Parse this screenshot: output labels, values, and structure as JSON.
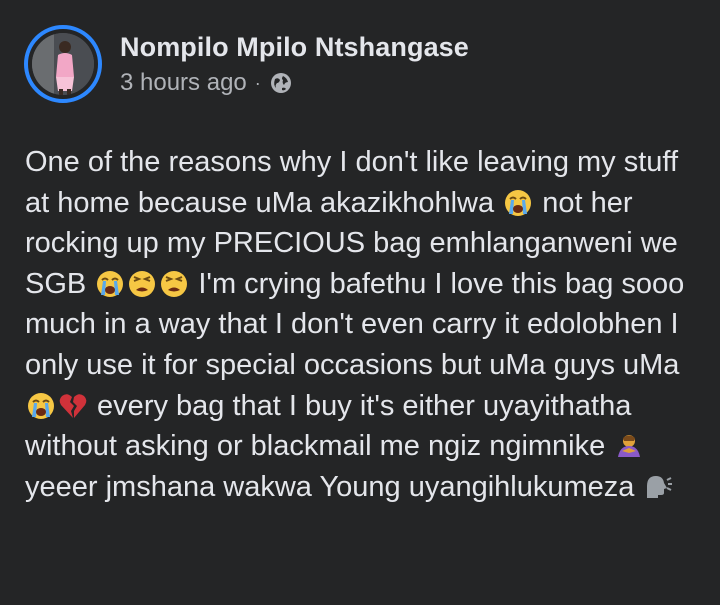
{
  "post": {
    "author_name": "Nompilo Mpilo Ntshangase",
    "timestamp": "3 hours ago",
    "separator": "·",
    "privacy_icon": "globe-icon",
    "text_segments": [
      "One of the reasons why I don't like leaving my stuff at home because uMa akazikhohlwa ",
      " not her rocking up my PRECIOUS bag emhlanganweni we SGB ",
      " I'm crying bafethu I love this bag sooo much in a way that I don't even carry it edolobhen I only use it for special occasions but uMa guys uMa",
      " every bag that I buy it's either uyayithatha without asking or blackmail me ngiz ngimnike ",
      " yeeer jmshana wakwa Young uyangihlukumeza "
    ],
    "emojis": {
      "e1": "loudly-crying-face",
      "e2": "loudly-crying-face",
      "e3": "weary-face",
      "e4": "weary-face",
      "e5": "loudly-crying-face",
      "e6": "broken-heart",
      "e7": "person-bowing",
      "e8": "speaking-head"
    }
  },
  "colors": {
    "background": "#242526",
    "primary_text": "#e4e6eb",
    "secondary_text": "#b0b3b8",
    "avatar_ring": "#2d88ff"
  }
}
